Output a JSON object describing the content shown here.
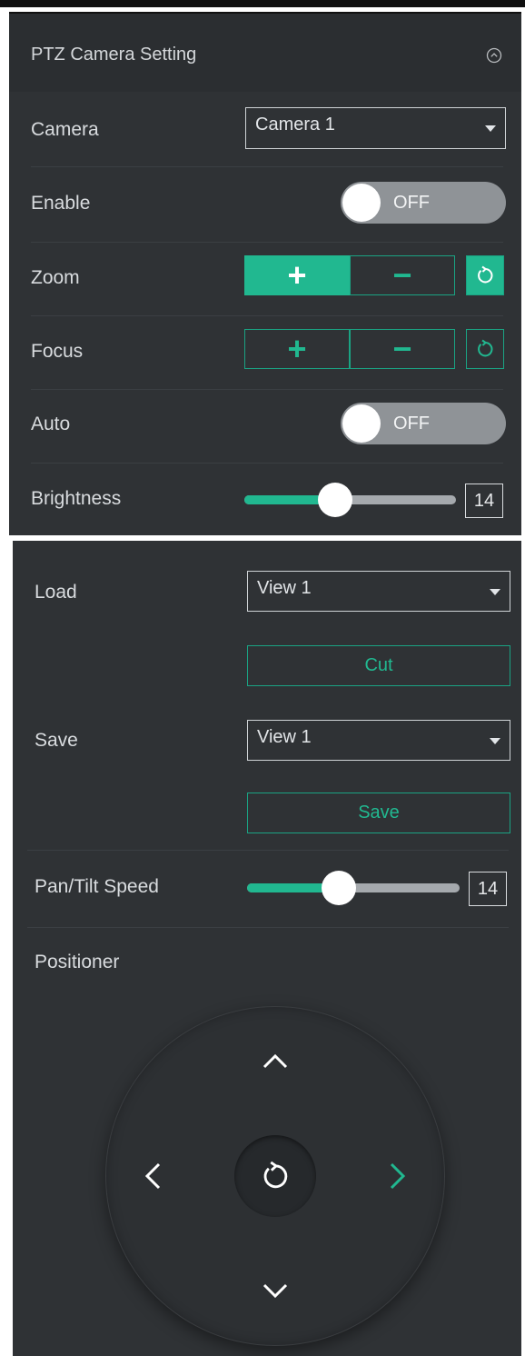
{
  "panel": {
    "title": "PTZ Camera Setting",
    "icons": {
      "collapse": "chevron-up-circle-icon"
    }
  },
  "camera": {
    "label": "Camera",
    "selected": "Camera 1"
  },
  "enable": {
    "label": "Enable",
    "state": "OFF"
  },
  "zoom": {
    "label": "Zoom",
    "plus": "+",
    "minus": "−",
    "reset_icon": "reset-icon"
  },
  "focus": {
    "label": "Focus",
    "plus": "+",
    "minus": "−",
    "reset_icon": "reset-icon"
  },
  "auto": {
    "label": "Auto",
    "state": "OFF"
  },
  "brightness": {
    "label": "Brightness",
    "value": "14",
    "fill_fraction": 0.43
  },
  "load": {
    "label": "Load",
    "selected": "View 1",
    "button": "Cut"
  },
  "save": {
    "label": "Save",
    "selected": "View 1",
    "button": "Save"
  },
  "pan_tilt_speed": {
    "label": "Pan/Tilt Speed",
    "value": "14",
    "fill_fraction": 0.43
  },
  "positioner": {
    "label": "Positioner",
    "icons": {
      "up": "chevron-up-icon",
      "down": "chevron-down-icon",
      "left": "chevron-left-icon",
      "right": "chevron-right-icon",
      "center": "reset-icon"
    }
  },
  "colors": {
    "accent": "#21b890",
    "panel_bg": "#2f3235",
    "header_bg": "#2b2e31",
    "toggle_off": "#8f9397"
  }
}
